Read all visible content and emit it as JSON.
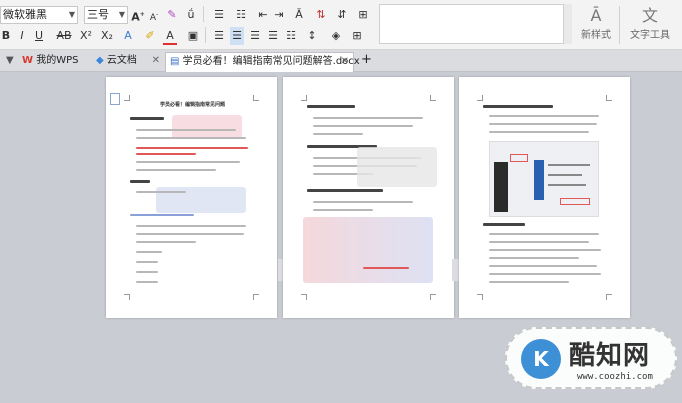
{
  "ribbon": {
    "font_name": "微软雅黑",
    "font_size": "三号",
    "grow_font_label": "A",
    "shrink_font_label": "A",
    "bold_label": "B",
    "italic_label": "I",
    "underline_label": "U",
    "strikethrough_label": "AB",
    "superscript_label": "X²",
    "subscript_label": "X₂",
    "styles_label": "新样式",
    "text_tools_label": "文字工具"
  },
  "tabs": [
    {
      "label": "我的WPS"
    },
    {
      "label": "云文档"
    },
    {
      "label": "学员必看！编辑指南常见问题解答.docx"
    }
  ],
  "new_tab_label": "+",
  "pages": [
    {
      "title": "学员必看！编辑指南常见问题"
    },
    {
      "title": ""
    },
    {
      "title": ""
    }
  ],
  "watermark": {
    "name": "酷知网",
    "url": "www.coozhi.com"
  },
  "colors": {
    "accent_red": "#e05858",
    "brand_blue": "#3d8fd6",
    "workspace": "#c9ccd3"
  }
}
